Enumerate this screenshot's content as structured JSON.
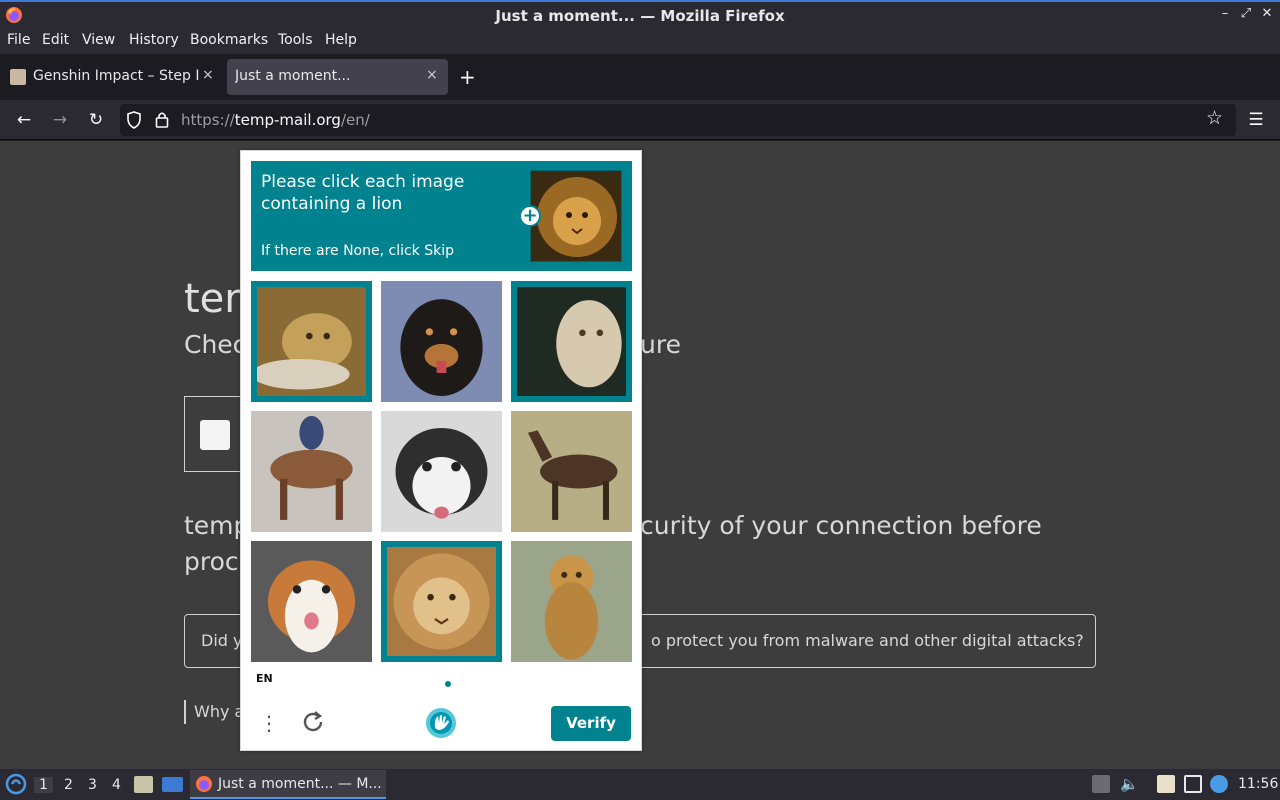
{
  "window": {
    "title": "Just a moment... — Mozilla Firefox"
  },
  "menu": [
    "File",
    "Edit",
    "View",
    "History",
    "Bookmarks",
    "Tools",
    "Help"
  ],
  "tabs": [
    {
      "label": "Genshin Impact – Step In",
      "active": false
    },
    {
      "label": "Just a moment...",
      "active": true
    }
  ],
  "tab_close": "×",
  "new_tab": "+",
  "address": {
    "scheme": "https://",
    "host": "temp-mail.org",
    "path": "/en/"
  },
  "page": {
    "heading_partial": "tem",
    "subheading_left": "Chec",
    "subheading_right": "ure",
    "para_line1_left": "temp",
    "para_line1_right": "curity of your connection before",
    "para_line2_left": "proc",
    "question_left": "Did y",
    "question_right": "o protect you from malware and other digital attacks?",
    "why_partial": "Why a"
  },
  "captcha": {
    "prompt": "Please click each image containing a lion",
    "hint": "If there are None, click Skip",
    "plus": "+",
    "tiles": [
      {
        "name": "lioness-tile",
        "selected": true
      },
      {
        "name": "dog-rottweiler-tile",
        "selected": false
      },
      {
        "name": "white-lion-tile",
        "selected": true
      },
      {
        "name": "horse-rider-tile",
        "selected": false
      },
      {
        "name": "husky-tile",
        "selected": false
      },
      {
        "name": "horse-tile",
        "selected": false
      },
      {
        "name": "corgi-tile",
        "selected": false
      },
      {
        "name": "lion-face-tile",
        "selected": true
      },
      {
        "name": "lion-cub-tile",
        "selected": false
      }
    ],
    "language": "EN",
    "menu_glyph": "⋮",
    "verify_label": "Verify",
    "accent": "#00838f"
  },
  "taskbar": {
    "workspaces": [
      "1",
      "2",
      "3",
      "4"
    ],
    "task_label": "Just a moment... — M...",
    "clock": "11:56"
  }
}
